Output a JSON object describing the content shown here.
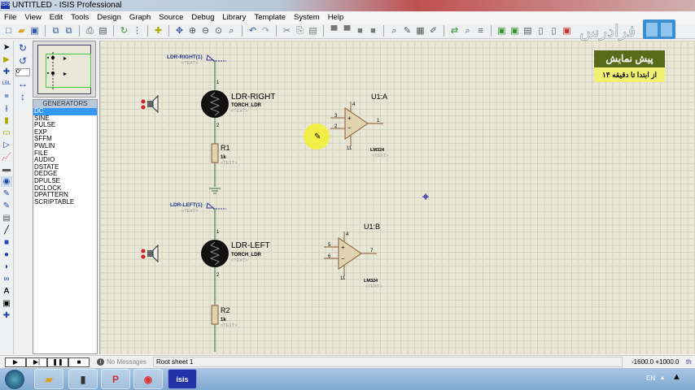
{
  "window": {
    "title": "UNTITLED - ISIS Professional",
    "icon": "ISIS"
  },
  "menu": [
    "File",
    "View",
    "Edit",
    "Tools",
    "Design",
    "Graph",
    "Source",
    "Debug",
    "Library",
    "Template",
    "System",
    "Help"
  ],
  "rotation": {
    "angle": "0°"
  },
  "device_list": {
    "header": "GENERATORS",
    "items": [
      "DC",
      "SINE",
      "PULSE",
      "EXP",
      "SFFM",
      "PWLIN",
      "FILE",
      "AUDIO",
      "DSTATE",
      "DEDGE",
      "DPULSE",
      "DCLOCK",
      "DPATTERN",
      "SCRIPTABLE"
    ],
    "selected": "DC"
  },
  "schematic": {
    "ldr_right": {
      "terminal": "LDR-RIGHT(1)",
      "text": "<TEXT>",
      "name": "LDR-RIGHT",
      "value": "TORCH_LDR",
      "pin1": "1",
      "pin2": "2"
    },
    "r1": {
      "name": "R1",
      "value": "1k",
      "text": "<TEXT>"
    },
    "u1a": {
      "name": "U1:A",
      "part": "LM324",
      "text": "<TEXT>",
      "pins": [
        "4",
        "3",
        "2",
        "11",
        "1"
      ]
    },
    "ldr_left": {
      "terminal": "LDR-LEFT(1)",
      "text": "<TEXT>",
      "name": "LDR-LEFT",
      "value": "TORCH_LDR",
      "pin1": "1",
      "pin2": "2"
    },
    "r2": {
      "name": "R2",
      "value": "1k",
      "text": "<TEXT>"
    },
    "u1b": {
      "name": "U1:B",
      "part": "LM324",
      "text": "<TEXT>",
      "pins": [
        "4",
        "5",
        "6",
        "11",
        "7"
      ]
    }
  },
  "status": {
    "messages": "No Messages",
    "sheet": "Root sheet 1",
    "coords": "-1600.0  +1000.0",
    "units": "th"
  },
  "taskbar": {
    "lang": "EN",
    "apps": [
      "explorer",
      "camera",
      "powerpoint",
      "chrome",
      "isis"
    ],
    "isis_label": "isis"
  },
  "overlay": {
    "brand": "فرادرس",
    "promo_title": "پیش نمایش",
    "promo_sub": "از ابتدا تا دقیقه ۱۴"
  }
}
